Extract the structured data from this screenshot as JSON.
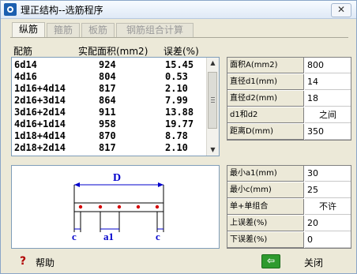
{
  "window": {
    "title": "理正结构--选筋程序",
    "close_glyph": "✕"
  },
  "tabs": [
    {
      "label": "纵筋",
      "active": true
    },
    {
      "label": "箍筋",
      "active": false
    },
    {
      "label": "板筋",
      "active": false
    },
    {
      "label": "钢筋组合计算",
      "active": false
    }
  ],
  "list": {
    "headers": {
      "config": "配筋",
      "area": "实配面积(mm2)",
      "error": "误差(%)"
    },
    "rows": [
      {
        "config": "6d14",
        "area": "924",
        "error": "15.45"
      },
      {
        "config": "4d16",
        "area": "804",
        "error": "0.53"
      },
      {
        "config": "1d16+4d14",
        "area": "817",
        "error": "2.10"
      },
      {
        "config": "2d16+3d14",
        "area": "864",
        "error": "7.99"
      },
      {
        "config": "3d16+2d14",
        "area": "911",
        "error": "13.88"
      },
      {
        "config": "4d16+1d14",
        "area": "958",
        "error": "19.77"
      },
      {
        "config": "1d18+4d14",
        "area": "870",
        "error": "8.78"
      },
      {
        "config": "2d18+2d14",
        "area": "817",
        "error": "2.10"
      }
    ]
  },
  "params_top": [
    {
      "label": "面积A(mm2)",
      "value": "800",
      "align": "left"
    },
    {
      "label": "直径d1(mm)",
      "value": "14",
      "align": "left"
    },
    {
      "label": "直径d2(mm)",
      "value": "18",
      "align": "left"
    },
    {
      "label": "d1和d2",
      "value": "之间",
      "align": "center"
    },
    {
      "label": "距离D(mm)",
      "value": "350",
      "align": "left"
    }
  ],
  "params_bottom": [
    {
      "label": "最小a1(mm)",
      "value": "30",
      "align": "left"
    },
    {
      "label": "最小c(mm)",
      "value": "25",
      "align": "left"
    },
    {
      "label": "单+单组合",
      "value": "不许",
      "align": "center"
    },
    {
      "label": "上误差(%)",
      "value": "20",
      "align": "left"
    },
    {
      "label": "下误差(%)",
      "value": "0",
      "align": "left"
    }
  ],
  "diagram": {
    "label_D": "D",
    "label_c": "c",
    "label_a1": "a1",
    "bar_color": "#d40000",
    "dim_color": "#0000cc"
  },
  "footer": {
    "help_label": "帮助",
    "help_glyph": "?",
    "close_label": "关闭",
    "back_glyph": "⇦"
  },
  "colors": {
    "accent": "#1b5fb0",
    "back_green": "#2e9a2e"
  }
}
